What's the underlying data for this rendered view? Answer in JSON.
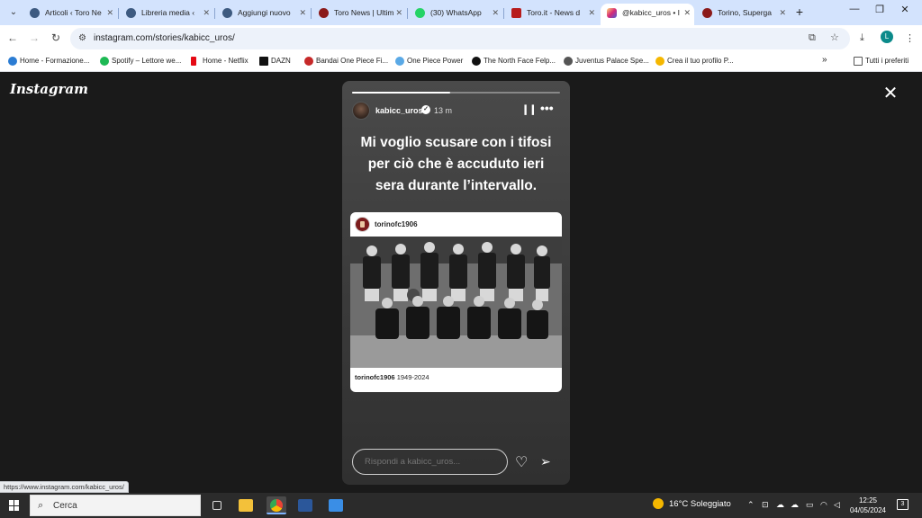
{
  "browser": {
    "tabs": [
      {
        "title": "Articoli ‹ Toro Ne",
        "icon": "wordpress-icon",
        "color": "#3d5a80"
      },
      {
        "title": "Libreria media ‹",
        "icon": "wordpress-icon",
        "color": "#3d5a80"
      },
      {
        "title": "Aggiungi nuovo",
        "icon": "wordpress-icon",
        "color": "#3d5a80"
      },
      {
        "title": "Toro News | Ultim",
        "icon": "toro-news-icon",
        "color": "#8b1a1a"
      },
      {
        "title": "(30) WhatsApp",
        "icon": "whatsapp-icon",
        "color": "#25d366"
      },
      {
        "title": "Toro.it - News d",
        "icon": "toro-it-icon",
        "color": "#b71c1c"
      },
      {
        "title": "@kabicc_uros • I",
        "icon": "instagram-icon",
        "color": "#e1306c"
      },
      {
        "title": "Torino, Superga",
        "icon": "toro-news-icon",
        "color": "#8b1a1a"
      }
    ],
    "new_tab": "+",
    "url": "instagram.com/stories/kabicc_uros/",
    "profile_initial": "L",
    "bookmarks": [
      {
        "label": "Home - Formazione...",
        "color": "#2b7cd3"
      },
      {
        "label": "Spotify – Lettore we...",
        "color": "#1db954"
      },
      {
        "label": "Home - Netflix",
        "color": "#e50914"
      },
      {
        "label": "DAZN",
        "color": "#111111"
      },
      {
        "label": "Bandai One Piece Fi...",
        "color": "#c62828"
      },
      {
        "label": "One Piece Power",
        "color": "#5aa9e6"
      },
      {
        "label": "The North Face Felp...",
        "color": "#111111"
      },
      {
        "label": "Juventus Palace Spe...",
        "color": "#555555"
      },
      {
        "label": "Crea il tuo profilo P...",
        "color": "#f5b700"
      }
    ],
    "bookmarks_more": "»",
    "all_bookmarks": "Tutti i preferiti",
    "status_url": "https://www.instagram.com/kabicc_uros/"
  },
  "instagram": {
    "logo": "Instagram",
    "story": {
      "progress": 0.47,
      "username": "kabicc_uros",
      "time_ago": "13 m",
      "text": "Mi voglio scusare con i tifosi per ciò che è accuduto ieri sera durante l’intervallo.",
      "post": {
        "username": "torinofc1906",
        "caption_user": "torinofc1906",
        "caption_text": "1949-2024"
      },
      "reply_placeholder": "Rispondi a kabicc_uros..."
    }
  },
  "taskbar": {
    "search_label": "Cerca",
    "weather": "16°C Soleggiato",
    "time": "12:25",
    "date": "04/05/2024",
    "notifications": "3"
  }
}
